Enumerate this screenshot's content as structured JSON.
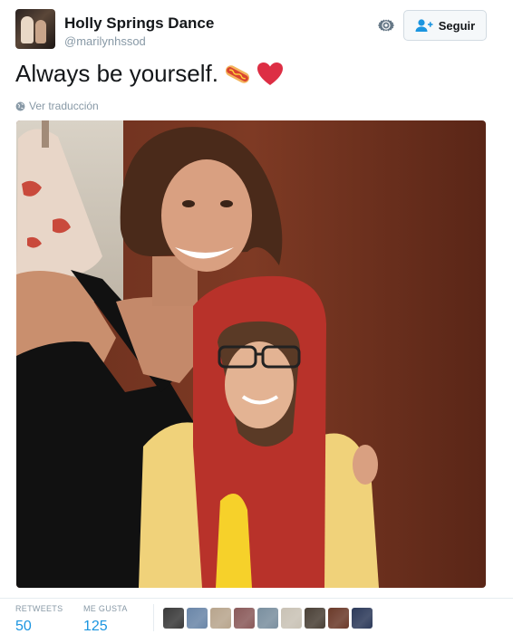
{
  "account": {
    "display_name": "Holly Springs Dance",
    "handle": "@marilynhssod",
    "avatar_icon": "profile-photo"
  },
  "actions": {
    "follow_label": "Seguir",
    "follow_icon": "add-user-icon",
    "settings_icon": "gear-icon"
  },
  "tweet": {
    "text": "Always be yourself.",
    "emojis": [
      "hot-dog-emoji",
      "red-heart-emoji"
    ],
    "translate_label": "Ver traducción",
    "translate_icon": "globe-icon"
  },
  "stats": {
    "retweets_label": "RETWEETS",
    "retweets_value": "50",
    "likes_label": "ME GUSTA",
    "likes_value": "125",
    "liker_colors": [
      "#3a3a3a",
      "#6a86a8",
      "#b8a58d",
      "#8a5a5a",
      "#7a8f9f",
      "#c9c2b5",
      "#4a4036",
      "#6b3a2a",
      "#2d3a5a"
    ]
  },
  "colors": {
    "accent": "#1b95e0",
    "muted": "#8899a6",
    "text": "#14171a"
  }
}
